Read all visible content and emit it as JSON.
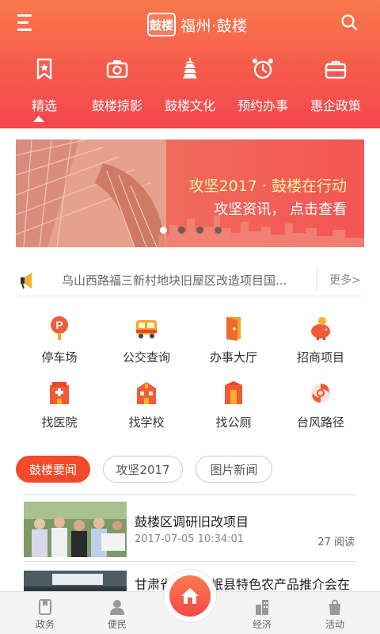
{
  "header": {
    "brand_logo_text": "鼓楼",
    "brand_title": "福州·鼓楼",
    "nav": [
      {
        "label": "精选",
        "icon": "bookmark-star-icon",
        "active": true
      },
      {
        "label": "鼓楼掠影",
        "icon": "camera-icon",
        "active": false
      },
      {
        "label": "鼓楼文化",
        "icon": "pagoda-icon",
        "active": false
      },
      {
        "label": "预约办事",
        "icon": "alarm-clock-icon",
        "active": false
      },
      {
        "label": "惠企政策",
        "icon": "briefcase-icon",
        "active": false
      }
    ]
  },
  "banner": {
    "title": "攻坚2017 · 鼓楼在行动",
    "subtitle": "攻坚资讯， 点击查看",
    "slide_count": 4,
    "active_slide": 1
  },
  "notice": {
    "text": "乌山西路福三新村地块旧屋区改造项目国...",
    "more": "更多>"
  },
  "services": [
    {
      "label": "停车场",
      "icon": "parking-icon"
    },
    {
      "label": "公交查询",
      "icon": "bus-icon"
    },
    {
      "label": "办事大厅",
      "icon": "door-icon"
    },
    {
      "label": "招商项目",
      "icon": "piggy-bank-icon"
    },
    {
      "label": "找医院",
      "icon": "hospital-icon"
    },
    {
      "label": "找学校",
      "icon": "school-icon"
    },
    {
      "label": "找公厕",
      "icon": "toilet-icon"
    },
    {
      "label": "台风路径",
      "icon": "typhoon-icon"
    }
  ],
  "news_tabs": [
    {
      "label": "鼓楼要闻",
      "active": true
    },
    {
      "label": "攻坚2017",
      "active": false
    },
    {
      "label": "图片新闻",
      "active": false
    }
  ],
  "news": [
    {
      "title": "鼓楼区调研旧改项目",
      "time": "2017-07-05 10:34:01",
      "reads": "27 阅读"
    },
    {
      "title": "甘肃省宕昌县岷县特色农产品推介会在",
      "time": "",
      "reads": ""
    }
  ],
  "tabbar": [
    {
      "label": "政务",
      "icon": "government-icon"
    },
    {
      "label": "便民",
      "icon": "person-icon"
    },
    {
      "label": "经济",
      "icon": "buildings-icon"
    },
    {
      "label": "活动",
      "icon": "shopping-bag-icon"
    }
  ],
  "colors": {
    "header_top": "#f9794b",
    "header_bottom": "#f3474f",
    "accent": "#f24a2a",
    "banner_title": "#fff3a0"
  }
}
